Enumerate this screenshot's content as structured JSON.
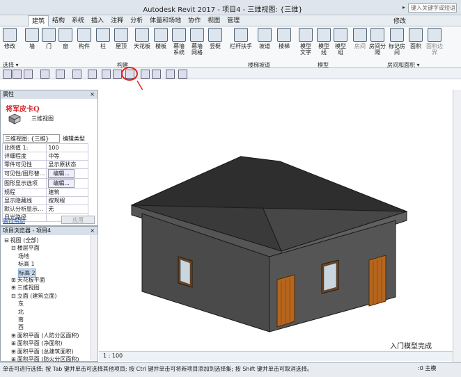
{
  "app": {
    "title": "Autodesk Revit 2017 -  项目4 - 三维视图: {三维}",
    "search_placeholder": "键入关键字或短语"
  },
  "ribbon": {
    "tabs": [
      "建筑",
      "结构",
      "系统",
      "插入",
      "注释",
      "分析",
      "体量和场地",
      "协作",
      "视图",
      "管理"
    ],
    "right_tab": "修改",
    "buttons": [
      {
        "label": "修改"
      },
      {
        "label": "墙"
      },
      {
        "label": "门"
      },
      {
        "label": "窗"
      },
      {
        "label": "构件"
      },
      {
        "label": "柱"
      },
      {
        "label": "屋顶"
      },
      {
        "label": "天花板"
      },
      {
        "label": "楼板"
      },
      {
        "label": "幕墙系统"
      },
      {
        "label": "幕墙网格"
      },
      {
        "label": "竖梃"
      },
      {
        "label": "栏杆扶手"
      },
      {
        "label": "坡道"
      },
      {
        "label": "楼梯"
      },
      {
        "label": "模型文字"
      },
      {
        "label": "模型线"
      },
      {
        "label": "模型组"
      },
      {
        "label": "房间"
      },
      {
        "label": "房间分隔"
      },
      {
        "label": "标记房间"
      },
      {
        "label": "面积"
      },
      {
        "label": "面积边界"
      }
    ],
    "panels": [
      "选择 ▾",
      "构建",
      "楼梯坡道",
      "模型",
      "房间和面积 ▾"
    ]
  },
  "properties": {
    "header": "属性",
    "close": "×",
    "type_name": "三维视图",
    "selector": "三维视图: {三维}",
    "edit_type": "编辑类型",
    "rows": [
      {
        "k": "比例值 1:",
        "v": "100"
      },
      {
        "k": "详细程度",
        "v": "中等"
      },
      {
        "k": "零件可见性",
        "v": "显示原状态"
      },
      {
        "k": "可见性/图形替...",
        "v": "编辑..."
      },
      {
        "k": "图形显示选项",
        "v": "编辑..."
      },
      {
        "k": "规程",
        "v": "建筑"
      },
      {
        "k": "显示隐藏线",
        "v": "按规程"
      },
      {
        "k": "默认分析显示...",
        "v": "无"
      },
      {
        "k": "日光路径",
        "v": ""
      }
    ],
    "help": "属性帮助",
    "apply": "应用"
  },
  "watermark": "将军皮卡Q",
  "browser": {
    "header": "项目浏览器 - 项目4",
    "close": "×",
    "nodes": [
      {
        "label": "视图 (全部)",
        "indent": 0,
        "exp": "⊟"
      },
      {
        "label": "楼层平面",
        "indent": 1,
        "exp": "⊟"
      },
      {
        "label": "场地",
        "indent": 2,
        "exp": ""
      },
      {
        "label": "标高 1",
        "indent": 2,
        "exp": ""
      },
      {
        "label": "标高 2",
        "indent": 2,
        "exp": ""
      },
      {
        "label": "天花板平面",
        "indent": 1,
        "exp": "⊞"
      },
      {
        "label": "三维视图",
        "indent": 1,
        "exp": "⊞"
      },
      {
        "label": "立面 (建筑立面)",
        "indent": 1,
        "exp": "⊟"
      },
      {
        "label": "东",
        "indent": 2,
        "exp": ""
      },
      {
        "label": "北",
        "indent": 2,
        "exp": ""
      },
      {
        "label": "南",
        "indent": 2,
        "exp": ""
      },
      {
        "label": "西",
        "indent": 2,
        "exp": ""
      },
      {
        "label": "面积平面 (人防分区面积)",
        "indent": 1,
        "exp": "⊞"
      },
      {
        "label": "面积平面 (净面积)",
        "indent": 1,
        "exp": "⊞"
      },
      {
        "label": "面积平面 (总建筑面积)",
        "indent": 1,
        "exp": "⊞"
      },
      {
        "label": "面积平面 (防火分区面积)",
        "indent": 1,
        "exp": "⊞"
      }
    ]
  },
  "view": {
    "scale": "1 : 100",
    "caption": "入门模型完成"
  },
  "status": {
    "text": "单击可进行选择; 按 Tab 键并单击可选择其他项目; 按 Ctrl 键并单击可将新项目添加到选择集; 按 Shift 键并单击可取消选择。",
    "right": ":0",
    "model_label": "主模"
  },
  "colors": {
    "highlight_circle": "#e2231a",
    "roof": "#3d3d3d",
    "wall_dark": "#4a4a4a",
    "door": "#b5651d"
  }
}
